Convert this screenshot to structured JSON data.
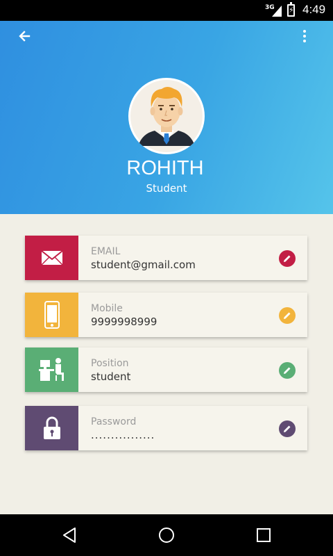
{
  "status_bar": {
    "network": "3G",
    "time": "4:49"
  },
  "profile": {
    "name": "ROHITH",
    "role": "Student"
  },
  "fields": [
    {
      "label": "EMAIL",
      "value": "student@gmail.com",
      "icon": "envelope-icon",
      "color": "#c21e45"
    },
    {
      "label": "Mobile",
      "value": "9999998999",
      "icon": "phone-icon",
      "color": "#f2b43c"
    },
    {
      "label": "Position",
      "value": "student",
      "icon": "desk-worker-icon",
      "color": "#5aae75"
    },
    {
      "label": "Password",
      "value": "................",
      "icon": "lock-icon",
      "color": "#5f4b72"
    }
  ],
  "colors": {
    "header_start": "#2f8fe0",
    "header_end": "#55c4ea",
    "background": "#f1efe6"
  }
}
